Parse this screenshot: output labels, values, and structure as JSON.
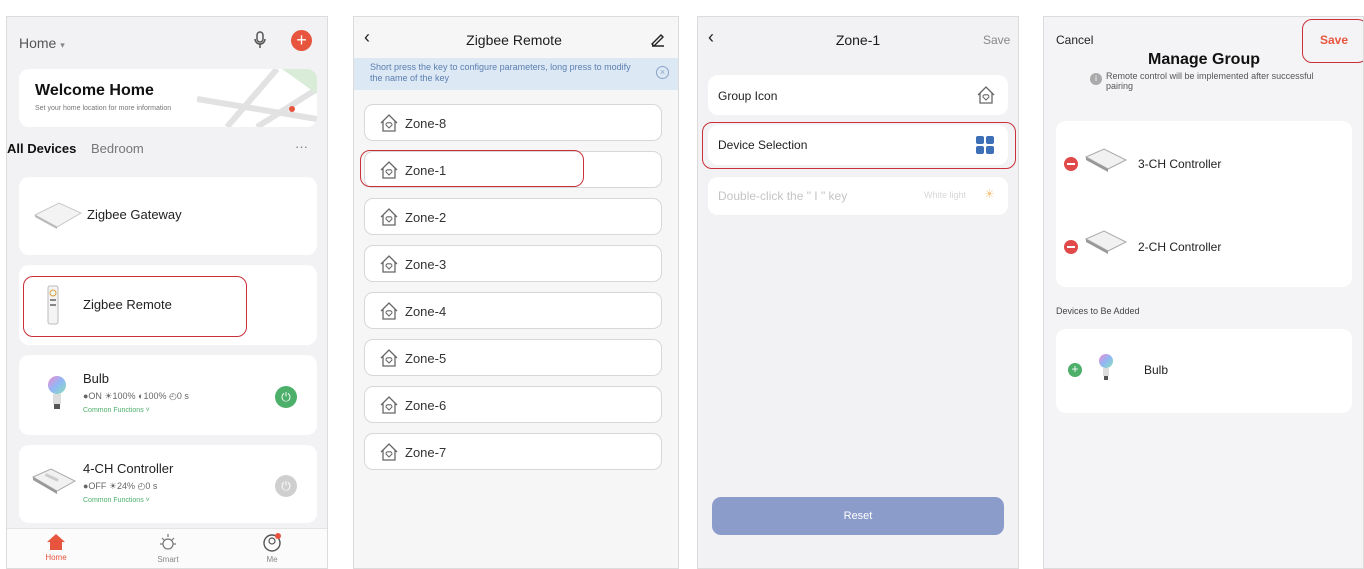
{
  "home_screen": {
    "home_dropdown": "Home",
    "welcome_title": "Welcome Home",
    "welcome_subtitle": "Set your home location for more information",
    "tabs": [
      "All Devices",
      "Bedroom"
    ],
    "more": "···",
    "devices": [
      {
        "name": "Zigbee Gateway"
      },
      {
        "name": "Zigbee Remote"
      },
      {
        "name": "Bulb",
        "status": "●ON  ☀100%  ◐100%  ◴0 s",
        "functions": "Common Functions ˅"
      },
      {
        "name": "4-CH Controller",
        "status": "●OFF  ☀24%  ◴0 s",
        "functions": "Common Functions ˅"
      }
    ],
    "bottom_tabs": [
      "Home",
      "Smart",
      "Me"
    ]
  },
  "remote_screen": {
    "title": "Zigbee Remote",
    "hint": "Short press the key to configure parameters, long press to modify the name of the key",
    "zones": [
      "Zone-8",
      "Zone-1",
      "Zone-2",
      "Zone-3",
      "Zone-4",
      "Zone-5",
      "Zone-6",
      "Zone-7"
    ]
  },
  "zone_screen": {
    "title": "Zone-1",
    "save": "Save",
    "group_icon": "Group Icon",
    "device_selection": "Device Selection",
    "double_click": "Double-click the \" I \" key",
    "double_click_value": "White light",
    "reset": "Reset"
  },
  "group_screen": {
    "cancel": "Cancel",
    "save": "Save",
    "title": "Manage Group",
    "note": "Remote control will be implemented after successful pairing",
    "devices": [
      "3-CH Controller",
      "2-CH Controller"
    ],
    "to_add_label": "Devices to Be Added",
    "to_add": [
      "Bulb"
    ]
  },
  "colors": {
    "accent": "#e8553e",
    "highlight": "#c9303a",
    "power_on": "#4caf6a",
    "reset_btn": "#8b9ccb",
    "hint_bg": "#dde8f5"
  }
}
